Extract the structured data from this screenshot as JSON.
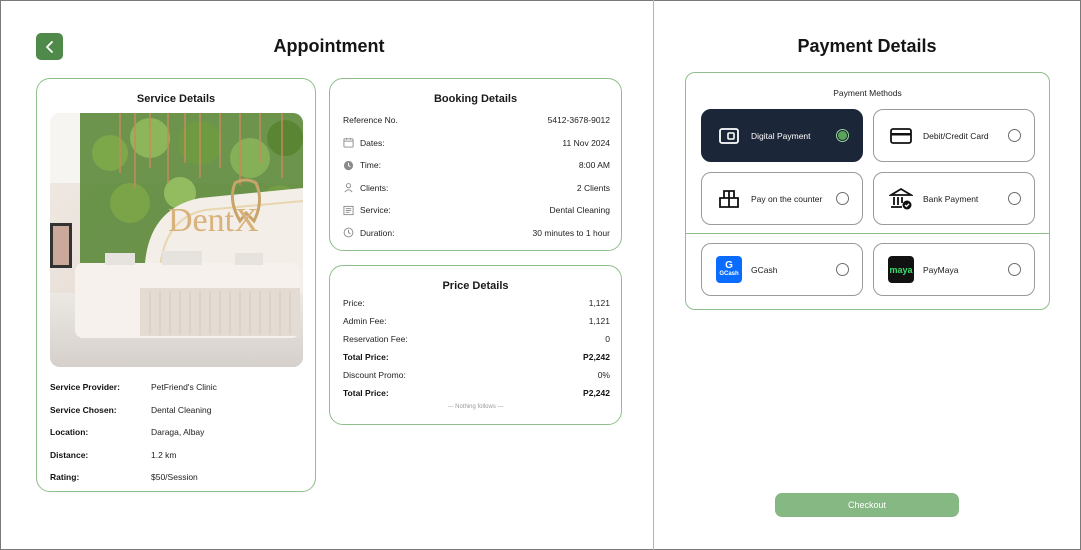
{
  "left": {
    "title": "Appointment"
  },
  "service": {
    "title": "Service Details",
    "image_text": "DentX",
    "rows": [
      {
        "label": "Service Provider:",
        "value": "PetFriend's Clinic"
      },
      {
        "label": "Service Chosen:",
        "value": "Dental Cleaning"
      },
      {
        "label": "Location:",
        "value": "Daraga, Albay"
      },
      {
        "label": "Distance:",
        "value": "1.2 km"
      },
      {
        "label": "Rating:",
        "value": "$50/Session"
      }
    ]
  },
  "booking": {
    "title": "Booking Details",
    "rows": [
      {
        "label": "Reference No.",
        "value": "5412-3678-9012",
        "icon": "none"
      },
      {
        "label": "Dates:",
        "value": "11 Nov 2024",
        "icon": "calendar-icon"
      },
      {
        "label": "Time:",
        "value": "8:00 AM",
        "icon": "clock-icon"
      },
      {
        "label": "Clients:",
        "value": "2 Clients",
        "icon": "user-icon"
      },
      {
        "label": "Service:",
        "value": "Dental Cleaning",
        "icon": "service-icon"
      },
      {
        "label": "Duration:",
        "value": "30 minutes to 1 hour",
        "icon": "timer-icon"
      }
    ]
  },
  "price": {
    "title": "Price Details",
    "rows": [
      {
        "label": "Price:",
        "value": "1,121",
        "bold": false
      },
      {
        "label": "Admin Fee:",
        "value": "1,121",
        "bold": false
      },
      {
        "label": "Reservation Fee:",
        "value": "0",
        "bold": false
      },
      {
        "label": "Total Price:",
        "value": "P2,242",
        "bold": true
      },
      {
        "label": "Discount Promo:",
        "value": "0%",
        "bold": false
      },
      {
        "label": "Total Price:",
        "value": "P2,242",
        "bold": true
      }
    ],
    "footer": "--- Nothing follows ---"
  },
  "payment": {
    "title": "Payment Details",
    "methods_label": "Payment Methods",
    "methods": [
      {
        "label": "Digital Payment",
        "icon": "wallet-icon",
        "selected": true
      },
      {
        "label": "Debit/Credit Card",
        "icon": "credit-card-icon",
        "selected": false
      },
      {
        "label": "Pay on the counter",
        "icon": "counter-icon",
        "selected": false
      },
      {
        "label": "Bank Payment",
        "icon": "bank-icon",
        "selected": false
      },
      {
        "label": "GCash",
        "icon": "gcash-logo",
        "selected": false
      },
      {
        "label": "PayMaya",
        "icon": "paymaya-logo",
        "selected": false
      }
    ],
    "gcash_logo_text": "GCash",
    "paymaya_logo_text": "maya",
    "checkout_label": "Checkout"
  },
  "colors": {
    "accent_green": "#4f8a4a",
    "border_green": "#8fbf8b",
    "checkout_green": "#86b884",
    "selected_navy": "#1b2639",
    "gcash_blue": "#0a6cff",
    "paymaya_black": "#111111",
    "paymaya_green": "#3ddc6e"
  }
}
